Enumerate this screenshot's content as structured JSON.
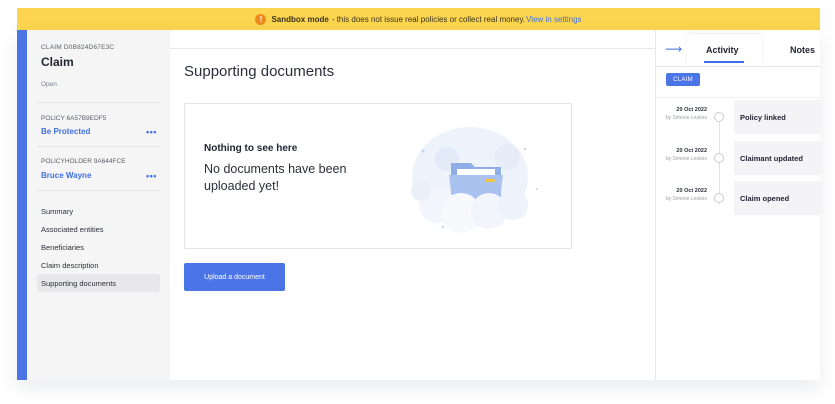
{
  "banner": {
    "mode_label": "Sandbox mode",
    "message": " - this does not issue real policies or collect real money.",
    "link": "View in settings",
    "color": "#fbd54e"
  },
  "sidebar": {
    "claim_id": "CLAIM D0B824D67E3C",
    "claim_title": "Claim",
    "claim_status": "Open",
    "policy_label": "POLICY 6A57B9EDF5",
    "policy_value": "Be Protected",
    "policyholder_label": "POLICYHOLDER 9A644FCE",
    "policyholder_value": "Bruce Wayne",
    "more": "•••",
    "nav": [
      {
        "label": "Summary"
      },
      {
        "label": "Associated entities"
      },
      {
        "label": "Beneficiaries"
      },
      {
        "label": "Claim description"
      },
      {
        "label": "Supporting documents",
        "active": true
      }
    ]
  },
  "main": {
    "title": "Supporting documents",
    "empty_heading": "Nothing to see here",
    "empty_message": "No documents have been uploaded yet!",
    "upload_button": "Upload a document",
    "accent": "#4b74e7"
  },
  "activity": {
    "collapse_icon": "arrow-right-icon",
    "tabs": [
      "Activity",
      "Notes"
    ],
    "filter_chip": "CLAIM",
    "events": [
      {
        "date": "20 Oct 2022",
        "by": "by Simone Leukes",
        "title": "Policy linked"
      },
      {
        "date": "20 Oct 2022",
        "by": "by Simone Leukes",
        "title": "Claimant updated"
      },
      {
        "date": "20 Oct 2022",
        "by": "by Simone Leukes",
        "title": "Claim opened"
      }
    ]
  }
}
